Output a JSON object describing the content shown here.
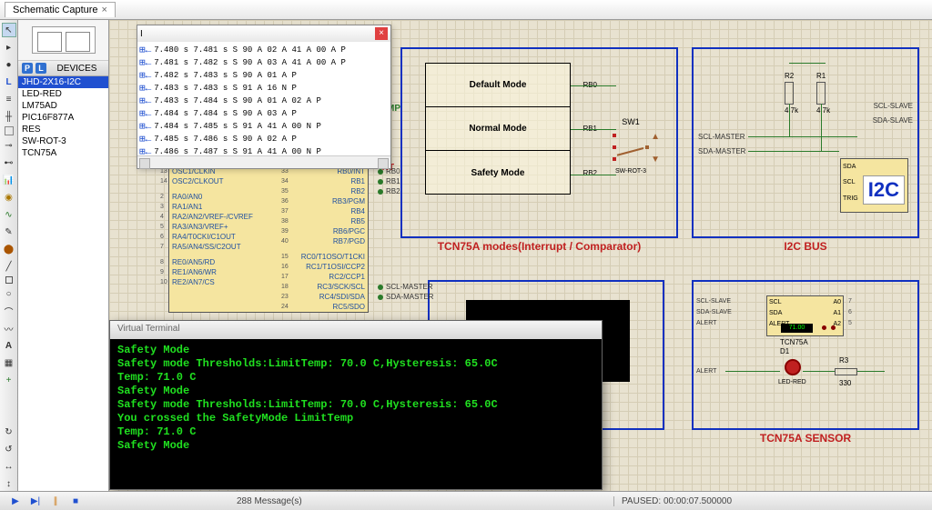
{
  "tab": {
    "title": "Schematic Capture"
  },
  "devices_header": "DEVICES",
  "devices": [
    "JHD-2X16-I2C",
    "LED-RED",
    "LM75AD",
    "PIC16F877A",
    "RES",
    "SW-ROT-3",
    "TCN75A"
  ],
  "log_rows": [
    "7.480 s   7.481 s S 90 A 02 A 41 A 00 A P",
    "7.481 s   7.482 s S 90 A 03 A 41 A 00 A P",
    "7.482 s   7.483 s S 90 A 01 A P",
    "7.483 s   7.483 s S 91 A 16 N P",
    "7.483 s   7.484 s S 90 A 01 A 02 A P",
    "7.484 s   7.484 s S 90 A 03 A P",
    "7.484 s   7.485 s S 91 A 41 A 00 N P",
    "7.485 s   7.486 s S 90 A 02 A P",
    "7.486 s   7.487 s S 91 A 41 A 00 N P"
  ],
  "mcu_left": [
    [
      "13",
      "OSC1/CLKIN"
    ],
    [
      "14",
      "OSC2/CLKOUT"
    ],
    [
      "2",
      "RA0/AN0"
    ],
    [
      "3",
      "RA1/AN1"
    ],
    [
      "4",
      "RA2/AN2/VREF-/CVREF"
    ],
    [
      "5",
      "RA3/AN3/VREF+"
    ],
    [
      "6",
      "RA4/T0CKI/C1OUT"
    ],
    [
      "7",
      "RA5/AN4/SS/C2OUT"
    ],
    [
      "8",
      "RE0/AN5/RD"
    ],
    [
      "9",
      "RE1/AN6/WR"
    ],
    [
      "10",
      "RE2/AN7/CS"
    ]
  ],
  "mcu_right": [
    [
      "RB0/INT",
      "33"
    ],
    [
      "RB1",
      "34"
    ],
    [
      "RB2",
      "35"
    ],
    [
      "RB3/PGM",
      "36"
    ],
    [
      "RB4",
      "37"
    ],
    [
      "RB5",
      "38"
    ],
    [
      "RB6/PGC",
      "39"
    ],
    [
      "RB7/PGD",
      "40"
    ],
    [
      "RC0/T1OSO/T1CKI",
      "15"
    ],
    [
      "RC1/T1OSI/CCP2",
      "16"
    ],
    [
      "RC2/CCP1",
      "17"
    ],
    [
      "RC3/SCK/SCL",
      "18"
    ],
    [
      "RC4/SDI/SDA",
      "23"
    ],
    [
      "RC5/SDO",
      "24"
    ]
  ],
  "mcu_nets_right": [
    "RB0",
    "RB1",
    "RB2",
    "",
    "",
    "",
    "",
    "",
    "",
    "",
    "",
    "SCL-MASTER",
    "SDA-MASTER",
    ""
  ],
  "modes": {
    "title": "TCN75A  modes(Interrupt / Comparator)",
    "items": [
      "Default Mode",
      "Normal Mode",
      "Safety Mode"
    ],
    "pins": [
      "RB0",
      "RB1",
      "RB2"
    ],
    "comp": "COMP",
    "int": "INT",
    "sw_name": "SW1",
    "sw_sub": "SW-ROT-3"
  },
  "i2c": {
    "title": "I2C BUS",
    "r1": "R1",
    "r2": "R2",
    "rval": "4.7k",
    "left_nets": [
      "SCL-MASTER",
      "SDA-MASTER"
    ],
    "right_nets": [
      "SCL-SLAVE",
      "SDA-SLAVE"
    ],
    "chip_pins": [
      "SDA",
      "SCL",
      "TRIG"
    ],
    "big": "I2C"
  },
  "sensor": {
    "title": "TCN75A  SENSOR",
    "left_nets": [
      "SCL-SLAVE",
      "SDA-SLAVE",
      "ALERT"
    ],
    "chip_left": [
      "SCL",
      "SDA",
      "ALERT"
    ],
    "chip_right": [
      "A0",
      "A1",
      "A2"
    ],
    "chip_rpins": [
      "7",
      "6",
      "5"
    ],
    "disp": "71.00",
    "chip_name": "TCN75A",
    "d1": "D1",
    "d1_sub": "LED-RED",
    "alert": "ALERT",
    "r3": "R3",
    "r3_val": "330"
  },
  "term": {
    "title": "Virtual Terminal",
    "lines": [
      "Safety Mode",
      "Safety mode Thresholds:LimitTemp: 70.0 C,Hysteresis: 65.0C",
      "Temp: 71.0 C",
      "Safety Mode",
      "Safety mode Thresholds:LimitTemp: 70.0 C,Hysteresis: 65.0C",
      "You crossed the SafetyMode LimitTemp",
      "Temp: 71.0 C",
      "Safety Mode"
    ]
  },
  "bottom": {
    "messages": "288 Message(s)",
    "status": "PAUSED: 00:00:07.500000"
  }
}
